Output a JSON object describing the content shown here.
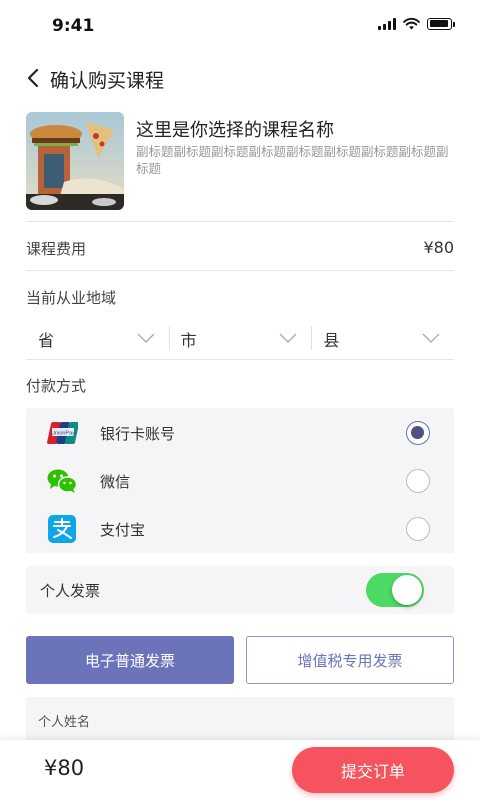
{
  "status_bar": {
    "time": "9:41",
    "battery_level": 0.9
  },
  "nav": {
    "title": "确认购买课程",
    "back_icon": "chevron-left-icon"
  },
  "course": {
    "name": "这里是你选择的课程名称",
    "subtitle": "副标题副标题副标题副标题副标题副标题副标题副标题副标题"
  },
  "fee": {
    "label": "课程费用",
    "value": "¥80"
  },
  "region": {
    "label": "当前从业地域",
    "selects": [
      {
        "placeholder": "省"
      },
      {
        "placeholder": "市"
      },
      {
        "placeholder": "县"
      }
    ]
  },
  "payment": {
    "label": "付款方式",
    "methods": [
      {
        "label": "银行卡账号",
        "icon": "unionpay-icon",
        "selected": true
      },
      {
        "label": "微信",
        "icon": "wechat-icon",
        "selected": false
      },
      {
        "label": "支付宝",
        "icon": "alipay-icon",
        "selected": false
      }
    ]
  },
  "invoice": {
    "label": "个人发票",
    "enabled": true,
    "types": [
      "电子普通发票",
      "增值税专用发票"
    ],
    "selected_type": "电子普通发票",
    "name_field_label": "个人姓名"
  },
  "footer": {
    "total": "¥80",
    "submit_label": "提交订单"
  },
  "colors": {
    "accent": "#6b74bb",
    "submit": "#f5535d",
    "toggle_on": "#4cd964",
    "radio_selected": "#4e5088"
  }
}
